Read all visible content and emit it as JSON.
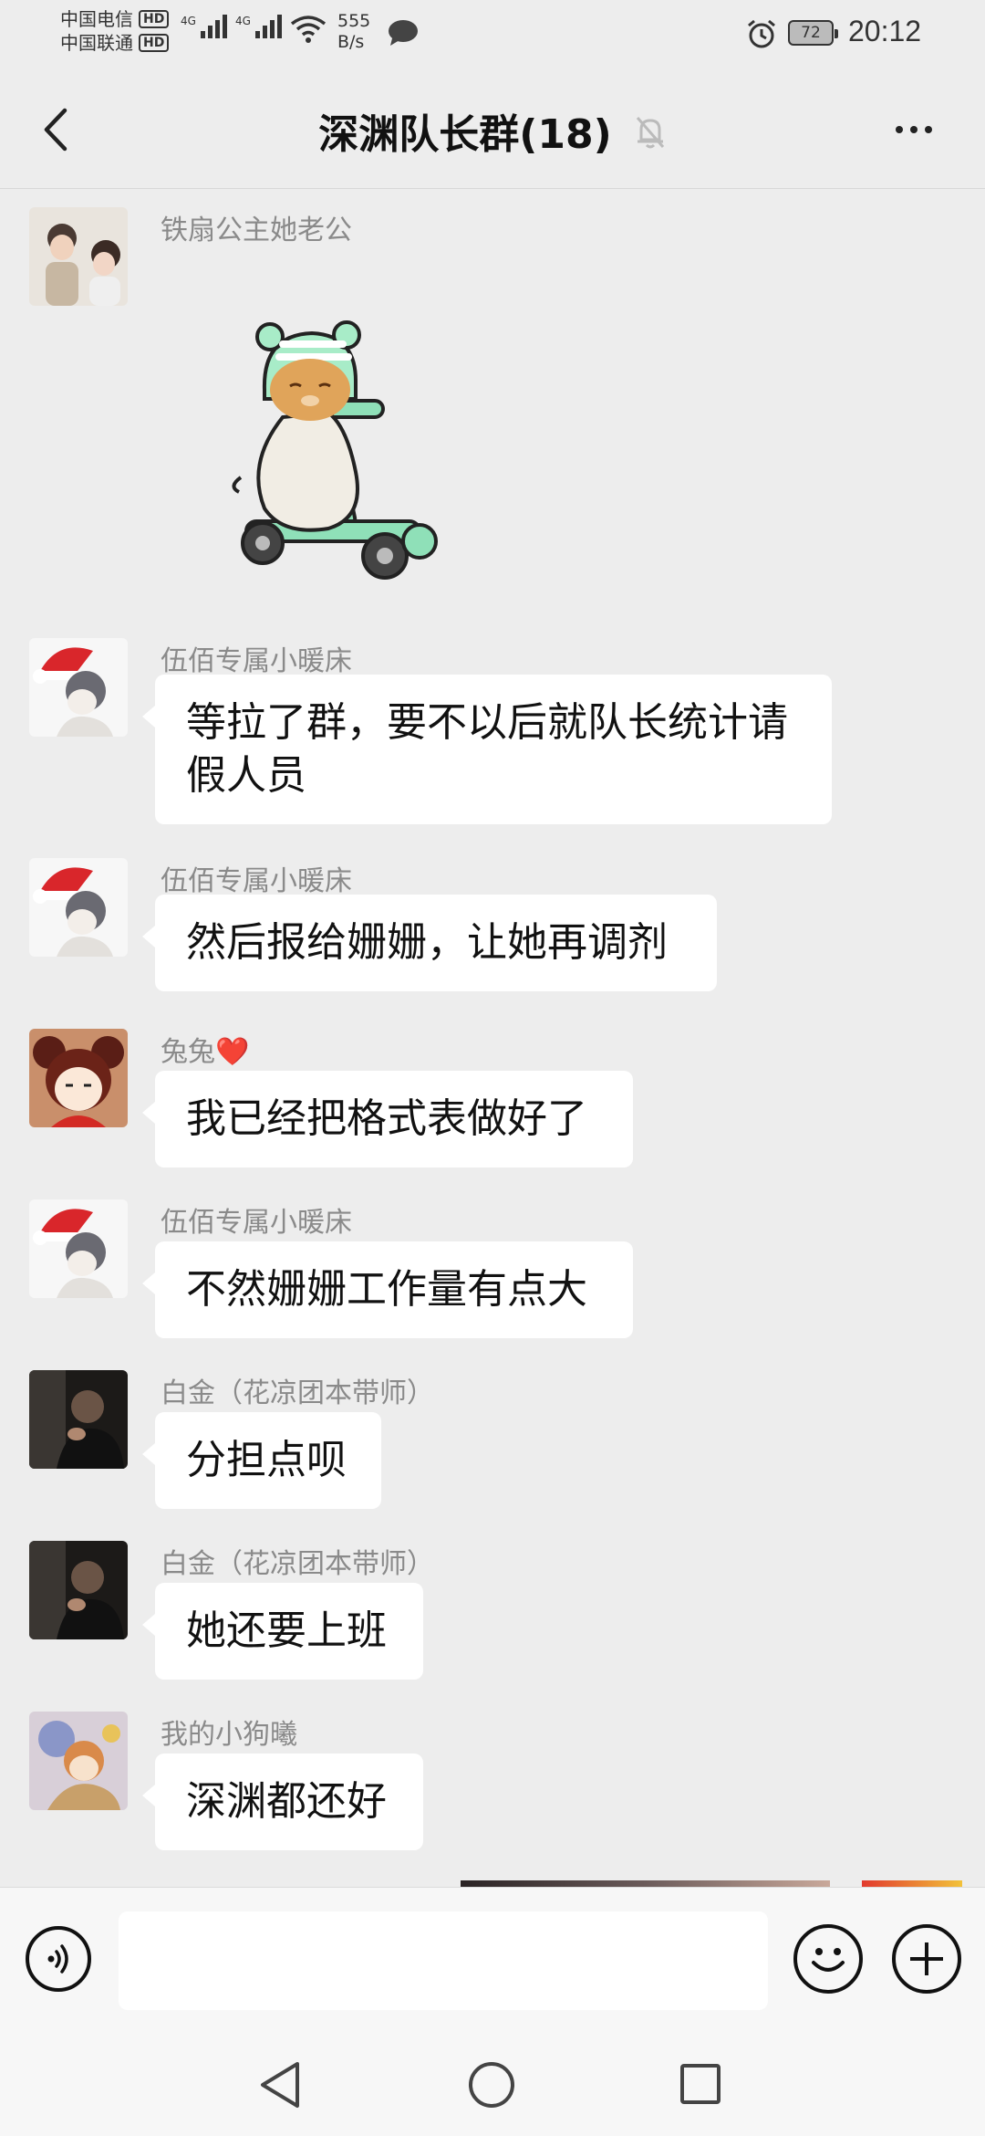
{
  "status_bar": {
    "carrier1": "中国电信",
    "carrier2": "中国联通",
    "hd": "HD",
    "network1": "4G",
    "network2": "4G",
    "net_speed_value": "555",
    "net_speed_unit": "B/s",
    "battery": "72",
    "time": "20:12"
  },
  "header": {
    "title": "深渊队长群(18)",
    "back_icon": "chevron-left-icon",
    "mute_icon": "bell-off-icon",
    "more_icon": "more-dots-icon"
  },
  "messages": [
    {
      "sender": "铁扇公主她老公",
      "type": "sticker",
      "sticker": "cat-on-scooter-sticker"
    },
    {
      "sender": "伍佰专属小暖床",
      "type": "text",
      "text_line1": "等拉了群，要不以后就队长统计请",
      "text_line2": "假人员"
    },
    {
      "sender": "伍佰专属小暖床",
      "type": "text",
      "text": "然后报给姗姗，让她再调剂"
    },
    {
      "sender": "兔兔❤️",
      "type": "text",
      "text": "我已经把格式表做好了"
    },
    {
      "sender": "伍佰专属小暖床",
      "type": "text",
      "text": "不然姗姗工作量有点大"
    },
    {
      "sender": "白金（花凉团本带师）",
      "type": "text",
      "text": "分担点呗"
    },
    {
      "sender": "白金（花凉团本带师）",
      "type": "text",
      "text": "她还要上班"
    },
    {
      "sender": "我的小狗曦",
      "type": "text",
      "text": "深渊都还好"
    }
  ],
  "input_bar": {
    "placeholder": "",
    "voice_icon": "voice-icon",
    "emoji_icon": "emoji-icon",
    "plus_icon": "plus-icon"
  },
  "nav_bar": {
    "back_icon": "nav-back-icon",
    "home_icon": "nav-home-icon",
    "recent_icon": "nav-recent-icon"
  },
  "colors": {
    "background": "#ededed",
    "bubble": "#ffffff",
    "sender": "#8a8a8a"
  }
}
